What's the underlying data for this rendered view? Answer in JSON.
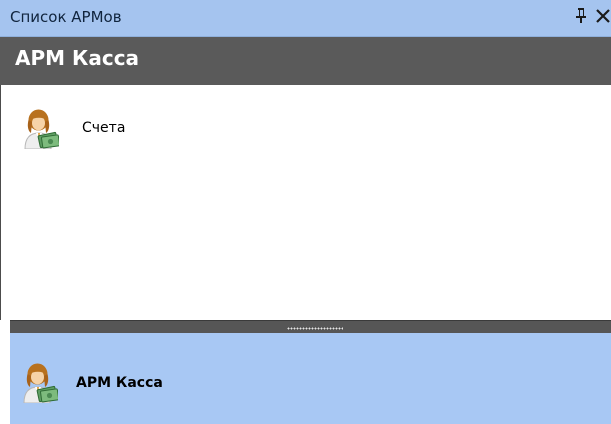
{
  "panel": {
    "title": "Список АРМов",
    "pin_icon": "pin-icon",
    "close_icon": "close-icon"
  },
  "section": {
    "title": "АРМ Касса"
  },
  "items": [
    {
      "label": "Счета",
      "icon": "user-money-icon"
    }
  ],
  "selected_workstation": {
    "label": "АРМ Касса",
    "icon": "user-money-icon"
  },
  "colors": {
    "titlebar": "#a5c4ef",
    "header": "#5a5a5a",
    "splitter": "#565656",
    "selection": "#a8c8f4"
  }
}
